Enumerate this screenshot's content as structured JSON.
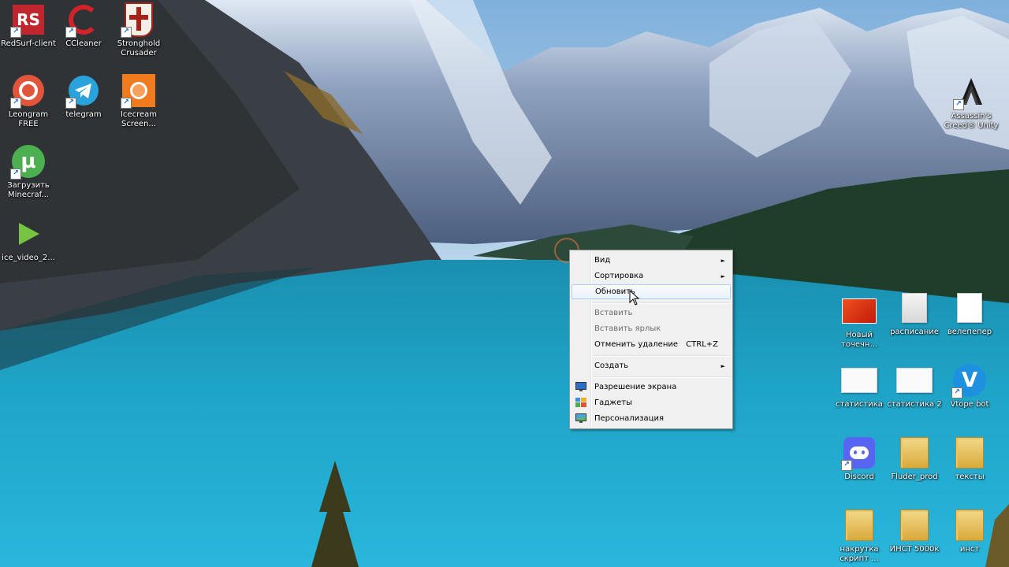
{
  "desktop": {
    "left_icons": [
      {
        "label": "RedSurf-client",
        "icon": "redsurf-icon",
        "color": "#c0262d"
      },
      {
        "label": "CCleaner",
        "icon": "ccleaner-icon",
        "color": "#d2232a"
      },
      {
        "label": "Stronghold\nCrusader",
        "icon": "stronghold-icon",
        "color": "#a8201a"
      },
      {
        "label": "Leongram\nFREE",
        "icon": "leongram-icon",
        "color": "#e2553a"
      },
      {
        "label": "telegram",
        "icon": "telegram-icon",
        "color": "#2aa3dc"
      },
      {
        "label": "Icecream\nScreen...",
        "icon": "icecream-icon",
        "color": "#f07a1e"
      },
      {
        "label": "Загрузить\nMinecraf...",
        "icon": "utorrent-icon",
        "color": "#4caf50"
      },
      {
        "label": "ice_video_2...",
        "icon": "video-play-icon",
        "color": "#76c442"
      }
    ],
    "right_icons": [
      {
        "label": "Assassin's\nCreed® Unity",
        "icon": "assassins-creed-icon"
      },
      {
        "label": "Новый\nточечн...",
        "icon": "bitmap-image-icon",
        "color": "#e23a1a"
      },
      {
        "label": "расписание",
        "icon": "text-document-icon"
      },
      {
        "label": "велепепер",
        "icon": "text-document-icon"
      },
      {
        "label": "статистика",
        "icon": "open-book-icon"
      },
      {
        "label": "статистика 2",
        "icon": "open-book-icon"
      },
      {
        "label": "Vtope bot",
        "icon": "vtope-icon",
        "color": "#1e90e0"
      },
      {
        "label": "Discord",
        "icon": "discord-icon",
        "color": "#5865f2"
      },
      {
        "label": "Fluder_prod",
        "icon": "folder-icon"
      },
      {
        "label": "тексты",
        "icon": "folder-icon"
      },
      {
        "label": "накрутка\nскрипт ...",
        "icon": "folder-icon"
      },
      {
        "label": "ИНСТ 5000к",
        "icon": "folder-icon"
      },
      {
        "label": "инст",
        "icon": "folder-icon"
      }
    ]
  },
  "context_menu": {
    "view": "Вид",
    "sort": "Сортировка",
    "refresh": "Обновить",
    "paste": "Вставить",
    "paste_shortcut": "Вставить ярлык",
    "undo_delete": "Отменить удаление",
    "undo_delete_keys": "CTRL+Z",
    "create": "Создать",
    "screen_resolution": "Разрешение экрана",
    "gadgets": "Гаджеты",
    "personalize": "Персонализация",
    "submenu_arrow": "►"
  }
}
